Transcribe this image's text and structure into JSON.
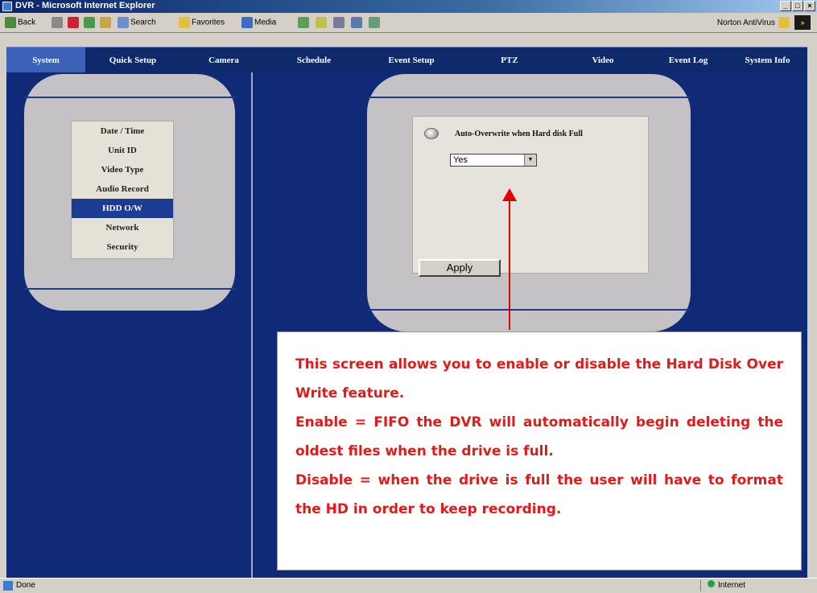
{
  "window": {
    "title": "DVR - Microsoft Internet Explorer",
    "buttons": [
      "_",
      "□",
      "×"
    ]
  },
  "toolbar": {
    "back": "Back",
    "search": "Search",
    "favorites": "Favorites",
    "media": "Media",
    "norton": "Norton AntiVirus"
  },
  "nav": {
    "tabs": [
      "System",
      "Quick Setup",
      "Camera",
      "Schedule",
      "Event Setup",
      "PTZ",
      "Video",
      "Event Log",
      "System Info"
    ],
    "active": "System"
  },
  "sidebar": {
    "items": [
      "Date / Time",
      "Unit ID",
      "Video Type",
      "Audio Record",
      "HDD O/W",
      "Network",
      "Security"
    ],
    "active": "HDD O/W"
  },
  "form": {
    "label": "Auto-Overwrite when Hard disk Full",
    "select_value": "Yes",
    "apply": "Apply"
  },
  "note": {
    "lines": [
      "This screen allows you to enable or disable the Hard Disk Over Write feature.",
      "Enable = FIFO the DVR will automatically begin deleting the oldest files when the drive is full.",
      "Disable = when the drive is full the user will have to format the HD in order to keep recording."
    ]
  },
  "status": {
    "left": "Done",
    "zone": "Internet"
  },
  "colors": {
    "nav_bg": "#0e2a6b",
    "active_tab": "#3c62b8",
    "main_bg": "#102a78",
    "note_text": "#e21a1a",
    "arrow": "#e10000"
  }
}
